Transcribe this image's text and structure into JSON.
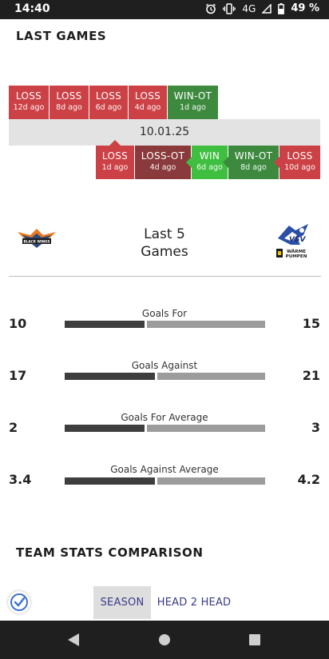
{
  "status_bar": {
    "time": "14:40",
    "network": "4G",
    "battery": "49 %"
  },
  "last_games": {
    "title": "LAST GAMES",
    "date": "10.01.25",
    "home_results": [
      {
        "result": "LOSS",
        "ago": "12d ago",
        "type": "loss"
      },
      {
        "result": "LOSS",
        "ago": "8d ago",
        "type": "loss"
      },
      {
        "result": "LOSS",
        "ago": "6d ago",
        "type": "loss"
      },
      {
        "result": "LOSS",
        "ago": "4d ago",
        "type": "loss"
      },
      {
        "result": "WIN-OT",
        "ago": "1d ago",
        "type": "win-ot"
      }
    ],
    "away_results": [
      {
        "result": "LOSS",
        "ago": "1d ago",
        "type": "loss"
      },
      {
        "result": "LOSS-OT",
        "ago": "4d ago",
        "type": "loss-ot"
      },
      {
        "result": "WIN",
        "ago": "6d ago",
        "type": "win"
      },
      {
        "result": "WIN-OT",
        "ago": "8d ago",
        "type": "win-ot"
      },
      {
        "result": "LOSS",
        "ago": "10d ago",
        "type": "loss"
      }
    ]
  },
  "comparison": {
    "heading_line1": "Last 5",
    "heading_line2": "Games",
    "home_logo_text": "BLACK WINGS",
    "away_logo_text": "WÄRME PUMPEN",
    "stats": [
      {
        "label": "Goals For",
        "home": "10",
        "away": "15",
        "home_share": 0.4
      },
      {
        "label": "Goals Against",
        "home": "17",
        "away": "21",
        "home_share": 0.45
      },
      {
        "label": "Goals For Average",
        "home": "2",
        "away": "3",
        "home_share": 0.4
      },
      {
        "label": "Goals Against Average",
        "home": "3.4",
        "away": "4.2",
        "home_share": 0.45
      }
    ]
  },
  "team_stats": {
    "title": "TEAM STATS COMPARISON",
    "tabs": [
      {
        "label": "SEASON",
        "active": true
      },
      {
        "label": "HEAD 2 HEAD",
        "active": false
      }
    ]
  },
  "colors": {
    "loss": "#cc4146",
    "loss_ot": "#8a3a3c",
    "win": "#3fbf3f",
    "win_ot": "#3d8a3f",
    "bar_dark": "#3e3e3e",
    "bar_light": "#9c9c9c",
    "tab_text": "#3a3a8c"
  },
  "icons": {
    "status": [
      "alarm-icon",
      "vibrate-icon",
      "signal-icon",
      "battery-icon"
    ],
    "nav": [
      "back-icon",
      "home-icon",
      "recents-icon"
    ],
    "floating": "verified-check-icon"
  }
}
